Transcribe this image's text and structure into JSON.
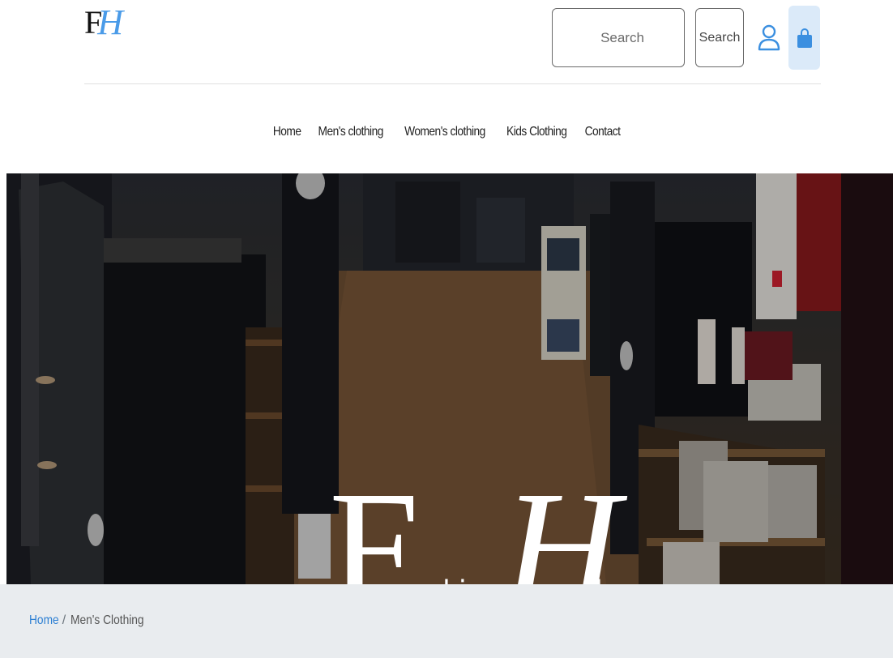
{
  "logo": {
    "letter_f": "F",
    "letter_h": "H"
  },
  "header": {
    "search_placeholder": "Search",
    "search_button_label": "Search",
    "user_icon": "user-icon",
    "bag_icon": "shopping-bag-icon",
    "accent_color": "#4a9be8"
  },
  "nav": {
    "items": [
      {
        "label": "Home"
      },
      {
        "label": "Men's clothing"
      },
      {
        "label": "Women's clothing"
      },
      {
        "label": "Kids Clothing"
      },
      {
        "label": "Contact"
      }
    ]
  },
  "hero": {
    "title_big_1": "F",
    "title_word_1": "ashion",
    "title_big_2": "H",
    "title_word_2": "ub"
  },
  "breadcrumb": {
    "home_label": "Home",
    "separator": "/",
    "current_label": "Men's Clothing"
  }
}
